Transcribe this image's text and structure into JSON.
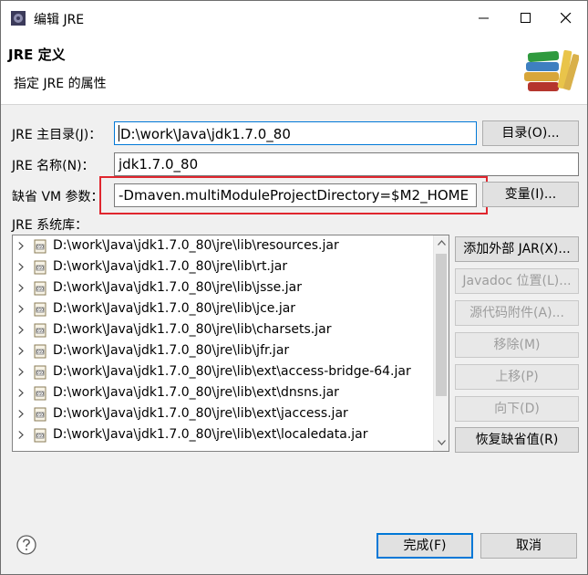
{
  "window": {
    "title": "编辑 JRE"
  },
  "header": {
    "title": "JRE 定义",
    "subtitle": "指定 JRE 的属性"
  },
  "form": {
    "home_label": "JRE 主目录(J)：",
    "home_value": "D:\\work\\Java\\jdk1.7.0_80",
    "home_button": "目录(O)...",
    "name_label": "JRE 名称(N)：",
    "name_value": "jdk1.7.0_80",
    "vmargs_label": "缺省 VM 参数：",
    "vmargs_value": "-Dmaven.multiModuleProjectDirectory=$M2_HOME",
    "vmargs_button": "变量(I)...",
    "libs_label": "JRE 系统库："
  },
  "libraries": [
    "D:\\work\\Java\\jdk1.7.0_80\\jre\\lib\\resources.jar",
    "D:\\work\\Java\\jdk1.7.0_80\\jre\\lib\\rt.jar",
    "D:\\work\\Java\\jdk1.7.0_80\\jre\\lib\\jsse.jar",
    "D:\\work\\Java\\jdk1.7.0_80\\jre\\lib\\jce.jar",
    "D:\\work\\Java\\jdk1.7.0_80\\jre\\lib\\charsets.jar",
    "D:\\work\\Java\\jdk1.7.0_80\\jre\\lib\\jfr.jar",
    "D:\\work\\Java\\jdk1.7.0_80\\jre\\lib\\ext\\access-bridge-64.jar",
    "D:\\work\\Java\\jdk1.7.0_80\\jre\\lib\\ext\\dnsns.jar",
    "D:\\work\\Java\\jdk1.7.0_80\\jre\\lib\\ext\\jaccess.jar",
    "D:\\work\\Java\\jdk1.7.0_80\\jre\\lib\\ext\\localedata.jar"
  ],
  "side_buttons": {
    "add_external_jar": "添加外部 JAR(X)...",
    "javadoc_location": "Javadoc 位置(L)...",
    "source_attachment": "源代码附件(A)...",
    "remove": "移除(M)",
    "move_up": "上移(P)",
    "move_down": "向下(D)",
    "restore_default": "恢复缺省值(R)"
  },
  "footer": {
    "finish": "完成(F)",
    "cancel": "取消"
  },
  "colors": {
    "highlight_border": "#e0262e",
    "focus_border": "#0078d7"
  },
  "icons": {
    "app": "eclipse-gear-icon",
    "header": "books-icon",
    "jar": "jar-file-icon",
    "help": "help-icon"
  }
}
